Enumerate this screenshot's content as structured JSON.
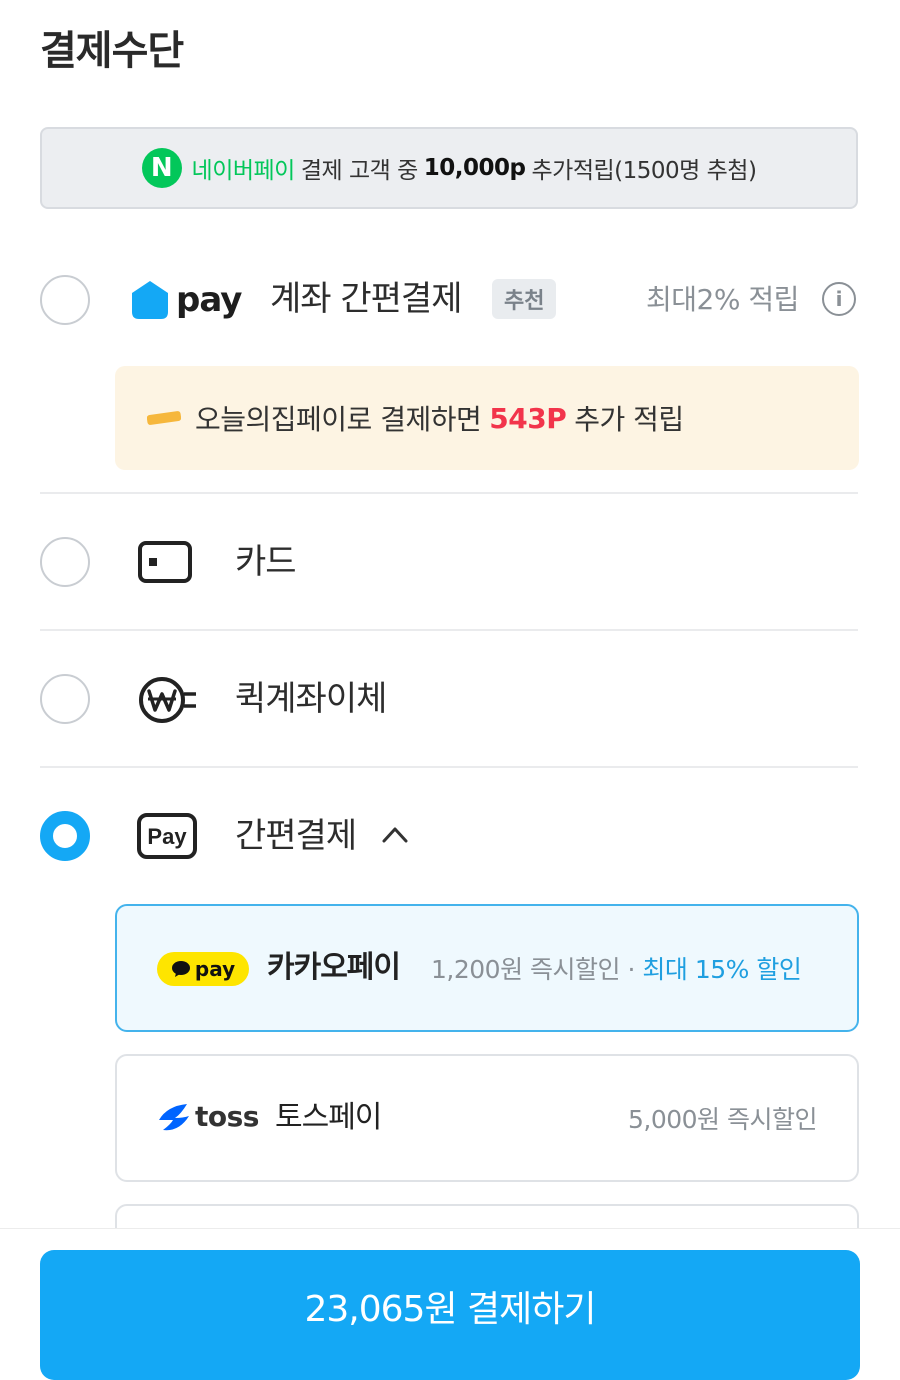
{
  "page": {
    "title": "결제수단"
  },
  "promo_banner": {
    "icon_letter": "N",
    "brand": "네이버페이",
    "text_before": "결제 고객 중",
    "amount": "10,000p",
    "text_after": "추가적립(1500명 추첨)"
  },
  "ohouse_pay": {
    "logo_word": "pay",
    "label": "계좌 간편결제",
    "badge": "추천",
    "reward": "최대2% 적립",
    "info_icon": "i",
    "banner": {
      "text_before": "오늘의집페이로 결제하면",
      "points": "543P",
      "text_after": "추가 적립"
    }
  },
  "methods": {
    "card": {
      "label": "카드"
    },
    "quick_transfer": {
      "label": "퀵계좌이체"
    },
    "easy_pay": {
      "label": "간편결제",
      "expanded": true,
      "chevron": "^"
    }
  },
  "easy_pay_options": {
    "kakao": {
      "badge": "pay",
      "name": "카카오페이",
      "desc": "1,200원 즉시할인 ·",
      "desc_highlight": "최대 15% 할인"
    },
    "toss": {
      "logo_word": "toss",
      "name": "토스페이",
      "desc": "5,000원 즉시할인"
    }
  },
  "pay_button": {
    "label": "23,065원 결제하기"
  },
  "colors": {
    "accent": "#14a8f5",
    "naver": "#03c75a",
    "points": "#f2344b",
    "kakao": "#fee500",
    "toss": "#0064ff"
  },
  "icons": [
    "naver-icon",
    "ohouse-house-icon",
    "info-icon",
    "coin-icon",
    "card-icon",
    "won-transfer-icon",
    "pay-box-icon",
    "chevron-up-icon",
    "kakao-bubble-icon",
    "toss-icon"
  ]
}
